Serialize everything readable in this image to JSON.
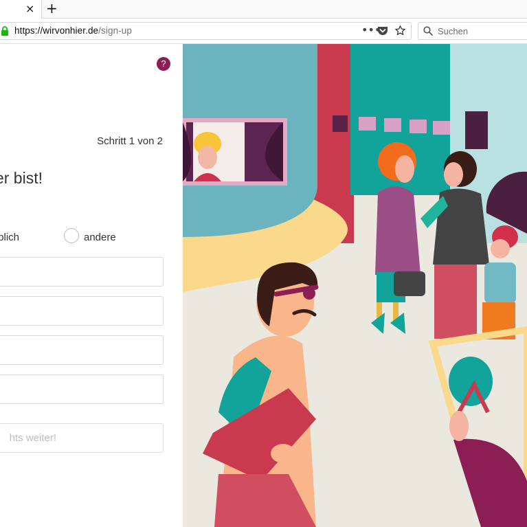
{
  "browser": {
    "tab_close_glyph": "×",
    "new_tab_glyph": "+",
    "url_host": "https://wirvonhier.de",
    "url_path": "/sign-up",
    "more_glyph": "•••",
    "search_placeholder": "Suchen",
    "icons": [
      "lock-icon",
      "more-icon",
      "pocket-icon",
      "star-icon",
      "search-icon"
    ]
  },
  "form": {
    "help_label": "?",
    "step": "Schritt 1 von 2",
    "heading": "er bist!",
    "gender_option_1": "blich",
    "gender_option_2": "andere",
    "submit_label": "hts weiter!",
    "accent_color": "#8c1d55"
  }
}
